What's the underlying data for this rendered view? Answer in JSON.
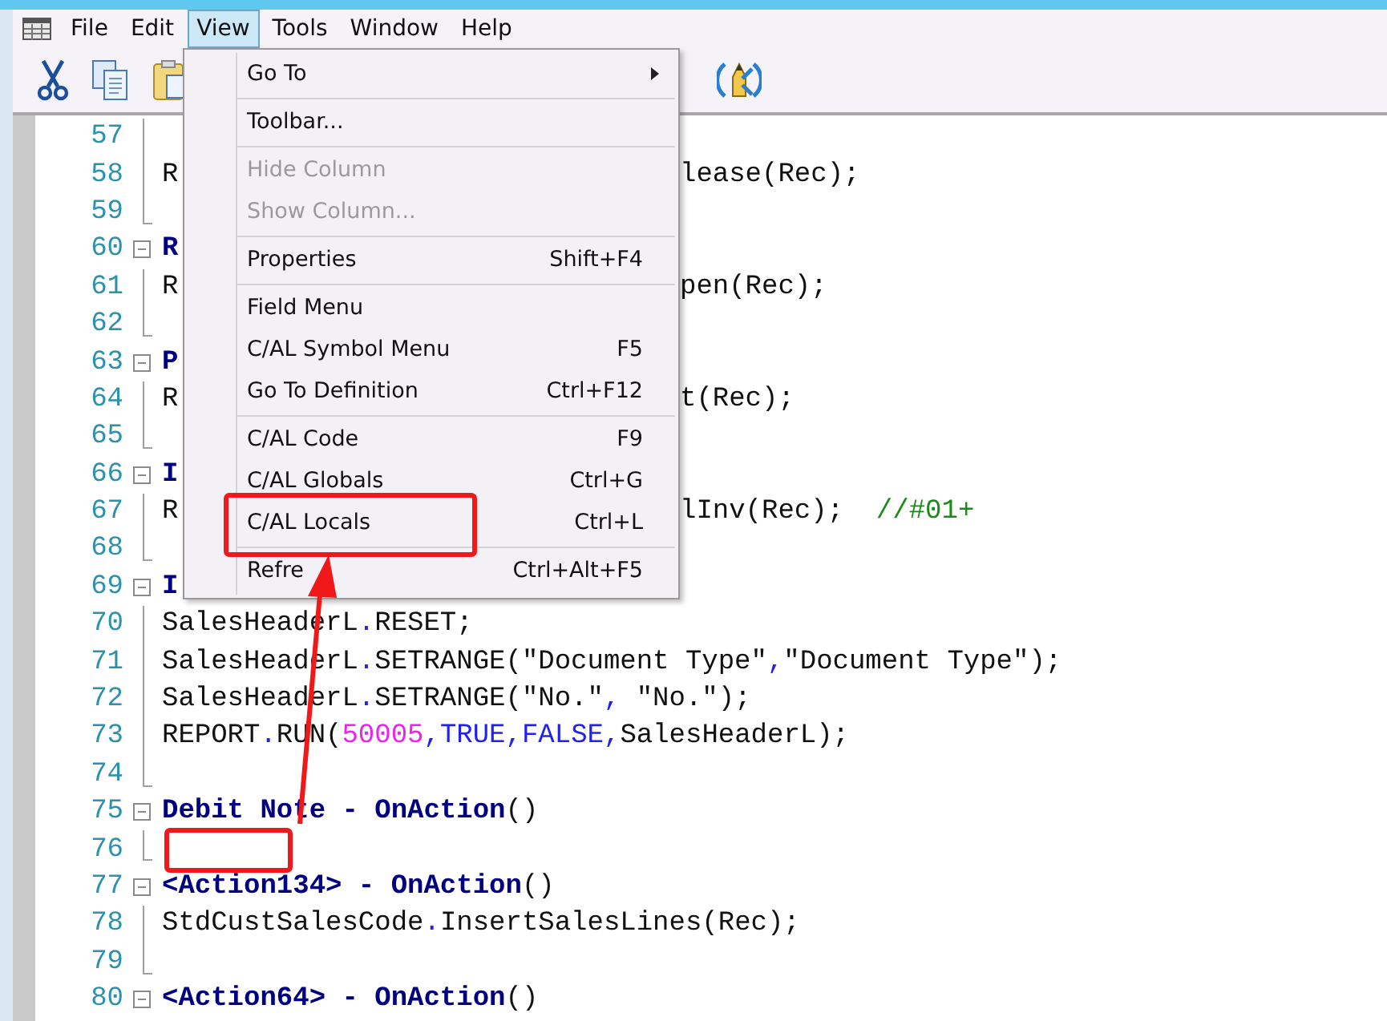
{
  "menu_bar": [
    {
      "label": "File",
      "selected": false
    },
    {
      "label": "Edit",
      "selected": false
    },
    {
      "label": "View",
      "selected": true
    },
    {
      "label": "Tools",
      "selected": false
    },
    {
      "label": "Window",
      "selected": false
    },
    {
      "label": "Help",
      "selected": false
    }
  ],
  "code_lines": [
    {
      "number": "57",
      "kind": "body"
    },
    {
      "number": "58",
      "kind": "body",
      "left": [
        {
          "text": "R",
          "kind": "plain"
        }
      ],
      "right": [
        {
          "text": "lease(Rec);",
          "kind": "plain"
        }
      ]
    },
    {
      "number": "59",
      "kind": "end"
    },
    {
      "number": "60",
      "kind": "start",
      "left": [
        {
          "text": "R",
          "kind": "bold"
        }
      ]
    },
    {
      "number": "61",
      "kind": "body",
      "left": [
        {
          "text": "R",
          "kind": "plain"
        }
      ],
      "right": [
        {
          "text": "pen(Rec);",
          "kind": "plain"
        }
      ]
    },
    {
      "number": "62",
      "kind": "end"
    },
    {
      "number": "63",
      "kind": "start",
      "left": [
        {
          "text": "P",
          "kind": "bold"
        }
      ]
    },
    {
      "number": "64",
      "kind": "body",
      "left": [
        {
          "text": "R",
          "kind": "plain"
        }
      ],
      "right": [
        {
          "text": "t(Rec);",
          "kind": "plain"
        }
      ]
    },
    {
      "number": "65",
      "kind": "end"
    },
    {
      "number": "66",
      "kind": "start",
      "left": [
        {
          "text": "I",
          "kind": "bold"
        }
      ]
    },
    {
      "number": "67",
      "kind": "body",
      "left": [
        {
          "text": "R",
          "kind": "plain"
        }
      ],
      "right": [
        {
          "text": "lInv(Rec);",
          "kind": "plain"
        },
        {
          "text": "  //#01+",
          "kind": "comment"
        }
      ]
    },
    {
      "number": "68",
      "kind": "end"
    },
    {
      "number": "69",
      "kind": "start",
      "left": [
        {
          "text": "I",
          "kind": "bold"
        }
      ]
    },
    {
      "number": "70",
      "kind": "body",
      "left": [
        {
          "text": "SalesHeaderL",
          "kind": "plain"
        },
        {
          "text": ".",
          "kind": "punct"
        },
        {
          "text": "RESET;",
          "kind": "plain"
        }
      ]
    },
    {
      "number": "71",
      "kind": "body",
      "left": [
        {
          "text": "SalesHeaderL",
          "kind": "plain"
        },
        {
          "text": ".",
          "kind": "punct"
        },
        {
          "text": "SETRANGE(\"Document Type\"",
          "kind": "plain"
        },
        {
          "text": ",",
          "kind": "punct"
        },
        {
          "text": "\"Document Type\");",
          "kind": "plain"
        }
      ]
    },
    {
      "number": "72",
      "kind": "body",
      "left": [
        {
          "text": "SalesHeaderL",
          "kind": "plain"
        },
        {
          "text": ".",
          "kind": "punct"
        },
        {
          "text": "SETRANGE(\"No.\"",
          "kind": "plain"
        },
        {
          "text": ",",
          "kind": "punct"
        },
        {
          "text": " \"No.\");",
          "kind": "plain"
        }
      ]
    },
    {
      "number": "73",
      "kind": "body",
      "left": [
        {
          "text": "REPORT",
          "kind": "plain"
        },
        {
          "text": ".",
          "kind": "punct"
        },
        {
          "text": "RUN(",
          "kind": "plain"
        },
        {
          "text": "50005",
          "kind": "number"
        },
        {
          "text": ",",
          "kind": "punct"
        },
        {
          "text": "TRUE",
          "kind": "constant"
        },
        {
          "text": ",",
          "kind": "punct"
        },
        {
          "text": "FALSE",
          "kind": "constant"
        },
        {
          "text": ",",
          "kind": "punct"
        },
        {
          "text": "SalesHeaderL);",
          "kind": "plain"
        }
      ]
    },
    {
      "number": "74",
      "kind": "end"
    },
    {
      "number": "75",
      "kind": "start",
      "left": [
        {
          "text": "Debit Note - OnAction",
          "kind": "bold"
        },
        {
          "text": "()",
          "kind": "plain"
        }
      ]
    },
    {
      "number": "76",
      "kind": "end"
    },
    {
      "number": "77",
      "kind": "start",
      "left": [
        {
          "text": "<Action134> - OnAction",
          "kind": "bold"
        },
        {
          "text": "()",
          "kind": "plain"
        }
      ]
    },
    {
      "number": "78",
      "kind": "body",
      "left": [
        {
          "text": "StdCustSalesCode",
          "kind": "plain"
        },
        {
          "text": ".",
          "kind": "punct"
        },
        {
          "text": "InsertSalesLines(Rec);",
          "kind": "plain"
        }
      ]
    },
    {
      "number": "79",
      "kind": "end"
    },
    {
      "number": "80",
      "kind": "start",
      "left": [
        {
          "text": "<Action64> - OnAction",
          "kind": "bold"
        },
        {
          "text": "()",
          "kind": "plain"
        }
      ]
    }
  ],
  "view_menu": [
    {
      "kind": "item",
      "label": "Go To",
      "submenu": true,
      "disabled": false
    },
    {
      "kind": "separator"
    },
    {
      "kind": "item",
      "label": "Toolbar...",
      "disabled": false
    },
    {
      "kind": "separator"
    },
    {
      "kind": "item",
      "label": "Hide Column",
      "disabled": true
    },
    {
      "kind": "item",
      "label": "Show Column...",
      "disabled": true
    },
    {
      "kind": "separator"
    },
    {
      "kind": "item",
      "label": "Properties",
      "shortcut": "Shift+F4",
      "disabled": false
    },
    {
      "kind": "separator"
    },
    {
      "kind": "item",
      "label": "Field Menu",
      "disabled": false
    },
    {
      "kind": "item",
      "label": "C/AL Symbol Menu",
      "shortcut": "F5",
      "disabled": false
    },
    {
      "kind": "item",
      "label": "Go To Definition",
      "shortcut": "Ctrl+F12",
      "disabled": false
    },
    {
      "kind": "separator"
    },
    {
      "kind": "item",
      "label": "C/AL Code",
      "shortcut": "F9",
      "disabled": false
    },
    {
      "kind": "item",
      "label": "C/AL Globals",
      "shortcut": "Ctrl+G",
      "disabled": false
    },
    {
      "kind": "item",
      "label": "C/AL Locals",
      "shortcut": "Ctrl+L",
      "disabled": false
    },
    {
      "kind": "separator"
    },
    {
      "kind": "item",
      "label": "Refre",
      "shortcut": "Ctrl+Alt+F5",
      "disabled": false
    }
  ]
}
